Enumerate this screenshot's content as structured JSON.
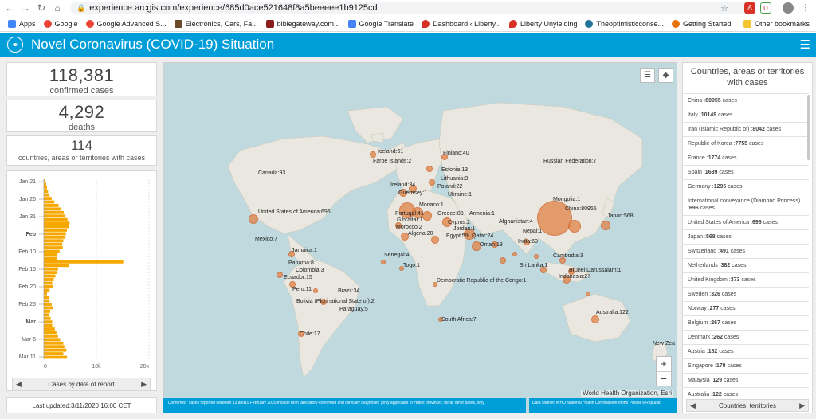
{
  "browser": {
    "url": "experience.arcgis.com/experience/685d0ace521648f8a5beeeee1b9125cd",
    "bookmarks": [
      "Apps",
      "Google",
      "Google Advanced S...",
      "Electronics, Cars, Fa...",
      "biblegateway.com...",
      "Google Translate",
      "Dashboard ‹ Liberty...",
      "Liberty Unyielding",
      "Theoptimisticconse...",
      "Getting Started"
    ],
    "other_bookmarks": "Other bookmarks"
  },
  "app": {
    "title": "Novel Coronavirus (COVID-19) Situation"
  },
  "stats": {
    "confirmed_value": "118,381",
    "confirmed_label": "confirmed cases",
    "deaths_value": "4,292",
    "deaths_label": "deaths",
    "countries_value": "114",
    "countries_label": "countries, areas or territories with cases"
  },
  "chart_data": {
    "type": "bar",
    "orientation": "horizontal",
    "title": "",
    "footer_label": "Cases by date of report",
    "y_tick_labels": [
      "Jan 21",
      "Jan 26",
      "Jan 31",
      "Feb",
      "Feb 10",
      "Feb 15",
      "Feb 20",
      "Feb 25",
      "Mar",
      "Mar 6",
      "Mar 11"
    ],
    "x_tick_labels": [
      "0",
      "10k",
      "20k"
    ],
    "xlim": [
      0,
      20000
    ],
    "categories": [
      "Jan 21",
      "Jan 22",
      "Jan 23",
      "Jan 24",
      "Jan 25",
      "Jan 26",
      "Jan 27",
      "Jan 28",
      "Jan 29",
      "Jan 30",
      "Jan 31",
      "Feb 1",
      "Feb 2",
      "Feb 3",
      "Feb 4",
      "Feb 5",
      "Feb 6",
      "Feb 7",
      "Feb 8",
      "Feb 9",
      "Feb 10",
      "Feb 11",
      "Feb 12",
      "Feb 13",
      "Feb 14",
      "Feb 15",
      "Feb 16",
      "Feb 17",
      "Feb 18",
      "Feb 19",
      "Feb 20",
      "Feb 21",
      "Feb 22",
      "Feb 23",
      "Feb 24",
      "Feb 25",
      "Feb 26",
      "Feb 27",
      "Feb 28",
      "Feb 29",
      "Mar 1",
      "Mar 2",
      "Mar 3",
      "Mar 4",
      "Mar 5",
      "Mar 6",
      "Mar 7",
      "Mar 8",
      "Mar 9",
      "Mar 10",
      "Mar 11"
    ],
    "values": [
      300,
      450,
      600,
      800,
      1100,
      1500,
      2000,
      2800,
      3300,
      3800,
      4100,
      4500,
      4900,
      4700,
      4400,
      4200,
      4100,
      3700,
      3500,
      3600,
      3000,
      2600,
      2500,
      15100,
      4800,
      2700,
      2500,
      2200,
      1900,
      1600,
      1700,
      1100,
      600,
      1000,
      1100,
      1500,
      1800,
      1200,
      1000,
      1300,
      1600,
      1600,
      2100,
      2400,
      2700,
      3100,
      3700,
      3900,
      4300,
      3700,
      4400
    ],
    "color": "#f7a800"
  },
  "updated": "Last updated:3/11/2020 16:00 CET",
  "map": {
    "attribution": "World Health Organization, Esri",
    "zoom_in": "+",
    "zoom_out": "−",
    "labels": [
      {
        "t": "Iceland:61"
      },
      {
        "t": "Finland:40"
      },
      {
        "t": "Faroe Islands:2"
      },
      {
        "t": "Russian Federation:7"
      },
      {
        "t": "Estonia:13"
      },
      {
        "t": "Canada:93"
      },
      {
        "t": "Lithuania:3"
      },
      {
        "t": "Ireland:34"
      },
      {
        "t": "Poland:22"
      },
      {
        "t": "Guernsey:1"
      },
      {
        "t": "Ukraine:1"
      },
      {
        "t": "Mongolia:1"
      },
      {
        "t": "Monaco:1"
      },
      {
        "t": "China:80955"
      },
      {
        "t": "United States of America:696"
      },
      {
        "t": "Portugal:41"
      },
      {
        "t": "Greece:89"
      },
      {
        "t": "Armenia:1"
      },
      {
        "t": "Japan:568"
      },
      {
        "t": "Gibraltar:1"
      },
      {
        "t": "Cyprus:2"
      },
      {
        "t": "Afghanistan:4"
      },
      {
        "t": "Morocco:2"
      },
      {
        "t": "Jordan:1"
      },
      {
        "t": "Nepal:1"
      },
      {
        "t": "Algeria:20"
      },
      {
        "t": "Egypt:59"
      },
      {
        "t": "Qatar:24"
      },
      {
        "t": "India:60"
      },
      {
        "t": "Mexico:7"
      },
      {
        "t": "Oman:18"
      },
      {
        "t": "Jamaica:1"
      },
      {
        "t": "Senegal:4"
      },
      {
        "t": "Cambodia:3"
      },
      {
        "t": "Sri Lanka:1"
      },
      {
        "t": "Panama:8"
      },
      {
        "t": "Togo:1"
      },
      {
        "t": "Brunei Darussalam:1"
      },
      {
        "t": "Colombia:3"
      },
      {
        "t": "Indonesia:27"
      },
      {
        "t": "Ecuador:15"
      },
      {
        "t": "Democratic Republic of the Congo:1"
      },
      {
        "t": "Peru:11"
      },
      {
        "t": "Brazil:34"
      },
      {
        "t": "Bolivia (Plurinational State of):2"
      },
      {
        "t": "Paraguay:5"
      },
      {
        "t": "Australia:122"
      },
      {
        "t": "South Africa:7"
      },
      {
        "t": "Chile:17"
      },
      {
        "t": "New Zea"
      }
    ],
    "footnote": "\"Confirmed\" cases reported between 13 and19 February 2020 include both laboratory-confirmed and clinically diagnosed (only  applicable to Hubei province); for all other dates, only",
    "datasource": "Data source: WHO National Health Commission of the People's Republic"
  },
  "right_panel": {
    "title": "Countries, areas or territories with cases",
    "items": [
      {
        "name": "China :",
        "count": "80955",
        "suffix": " cases"
      },
      {
        "name": "Italy :",
        "count": "10149",
        "suffix": " cases"
      },
      {
        "name": "Iran (Islamic Republic of) :",
        "count": "8042",
        "suffix": " cases"
      },
      {
        "name": "Republic of Korea :",
        "count": "7755",
        "suffix": " cases"
      },
      {
        "name": "France :",
        "count": "1774",
        "suffix": " cases"
      },
      {
        "name": "Spain :",
        "count": "1639",
        "suffix": " cases"
      },
      {
        "name": "Germany :",
        "count": "1296",
        "suffix": " cases"
      },
      {
        "name": "International conveyance (Diamond Princess) :",
        "count": "696",
        "suffix": " cases"
      },
      {
        "name": "United States of America :",
        "count": "696",
        "suffix": " cases"
      },
      {
        "name": "Japan :",
        "count": "568",
        "suffix": " cases"
      },
      {
        "name": "Switzerland :",
        "count": "491",
        "suffix": " cases"
      },
      {
        "name": "Netherlands :",
        "count": "382",
        "suffix": " cases"
      },
      {
        "name": "United Kingdom :",
        "count": "373",
        "suffix": " cases"
      },
      {
        "name": "Sweden :",
        "count": "326",
        "suffix": " cases"
      },
      {
        "name": "Norway :",
        "count": "277",
        "suffix": " cases"
      },
      {
        "name": "Belgium :",
        "count": "267",
        "suffix": " cases"
      },
      {
        "name": "Denmark :",
        "count": "262",
        "suffix": " cases"
      },
      {
        "name": "Austria :",
        "count": "182",
        "suffix": " cases"
      },
      {
        "name": "Singapore :",
        "count": "178",
        "suffix": " cases"
      },
      {
        "name": "Malaysia :",
        "count": "129",
        "suffix": " cases"
      },
      {
        "name": "Australia :",
        "count": "122",
        "suffix": " cases"
      }
    ],
    "footer_label": "Countries, territories"
  }
}
